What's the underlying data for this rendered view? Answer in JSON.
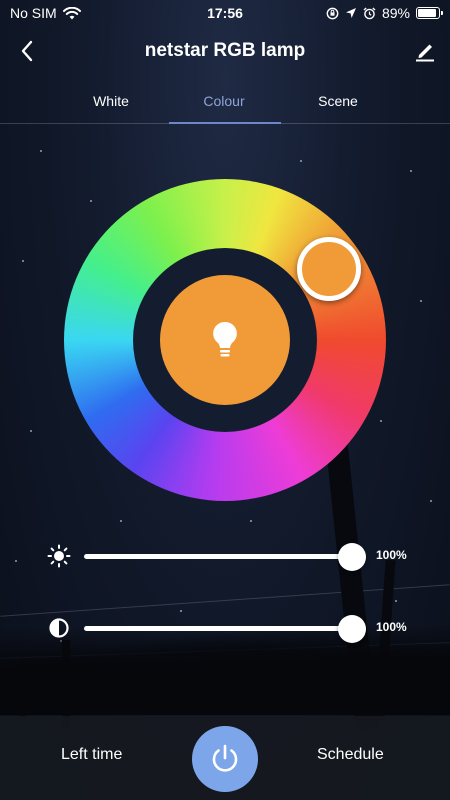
{
  "status_bar": {
    "carrier": "No SIM",
    "time": "17:56",
    "battery_percent": "89%",
    "battery_level": 0.89,
    "icons": [
      "wifi-icon",
      "screen-lock-rotation-icon",
      "location-arrow-icon",
      "alarm-clock-icon",
      "battery-icon"
    ]
  },
  "navbar": {
    "title": "netstar RGB lamp",
    "back_icon": "chevron-left-icon",
    "edit_icon": "pencil-edit-icon"
  },
  "tabs": [
    {
      "label": "White",
      "active": false
    },
    {
      "label": "Colour",
      "active": true
    },
    {
      "label": "Scene",
      "active": false
    }
  ],
  "colour": {
    "selected_color": "#f09a38",
    "center_icon": "light-bulb-icon"
  },
  "sliders": {
    "brightness": {
      "icon": "sun-brightness-icon",
      "value": 100,
      "label": "100%"
    },
    "saturation": {
      "icon": "contrast-icon",
      "value": 100,
      "label": "100%"
    }
  },
  "bottom_bar": {
    "left_time_label": "Left time",
    "schedule_label": "Schedule",
    "power_icon": "power-icon",
    "power_color": "#7da5ea"
  },
  "accent_color": "#8fa3d6"
}
